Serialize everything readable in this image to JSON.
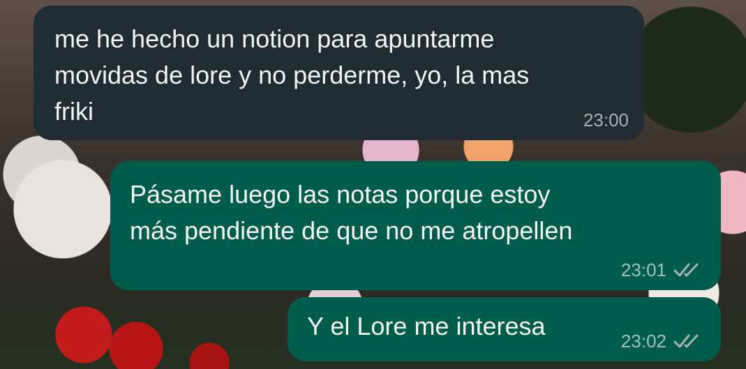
{
  "messages": [
    {
      "direction": "incoming",
      "text": "me he hecho un notion para apuntarme\nmovidas de lore y no perderme, yo, la mas\nfriki",
      "time": "23:00"
    },
    {
      "direction": "outgoing",
      "text": "Pásame luego las notas porque estoy\nmás pendiente de que no me atropellen",
      "time": "23:01",
      "status_icon": "double-check-icon"
    },
    {
      "direction": "outgoing",
      "text": "Y el Lore me interesa",
      "time": "23:02",
      "status_icon": "double-check-icon"
    }
  ],
  "colors": {
    "incoming_bubble": "#1f2c33",
    "outgoing_bubble": "#005c4b",
    "text": "#f2f4f5",
    "meta_text": "#a7b3b3"
  }
}
